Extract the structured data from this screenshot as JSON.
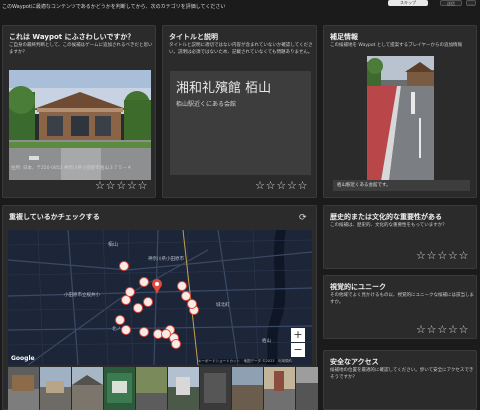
{
  "header": {
    "instruction": "このWaypotに最適なコンテンツであるかどうかを判断してから、次のカテゴリを評価してください",
    "skip_label": "スキップ",
    "next_label": "送信",
    "more_label": "…"
  },
  "eligibility": {
    "title": "これは Waypot にふさわしいですか？",
    "description": "ご自身の最終判断として、この候補はゲームに追加されるべきだと思いますか？",
    "address": "住所: 日本、〒250-0852 神奈川県小田原市栢山３７５－４",
    "stars": "☆☆☆☆☆"
  },
  "title_card": {
    "title": "タイトルと説明",
    "description": "タイトルと説明に適切ではない内容が含まれていないか確認してください。説明は必須ではないため、記載されていなくても問題ありません。",
    "poi_title": "湘和礼殯館 栢山",
    "poi_description": "栢山駅近くにある会館",
    "stars": "☆☆☆☆☆"
  },
  "supplementary": {
    "title": "補足情報",
    "description": "この候補地を Waypot として提案するプレイヤーからの追加情報",
    "caption": "栢山駅近くある会館です。",
    "stars": "☆☆☆☆☆"
  },
  "duplicates": {
    "title": "重複しているかチェックする",
    "map_labels": [
      "栢山",
      "神奈川県小田原市",
      "小田原市立桜井小",
      "城北町",
      "北ノ…",
      "栢山"
    ],
    "google_label": "Google",
    "attribution": "キーボードショートカット　地図データ ©2023　利用規約",
    "zoom_in": "+",
    "zoom_out": "−",
    "refresh_icon": "refresh-icon"
  },
  "historic": {
    "title": "歴史的または文化的な重要性がある",
    "description": "この候補は、歴史的、文化的な重要性をもっていますか？",
    "stars": "☆☆☆☆☆"
  },
  "visual": {
    "title": "視覚的にユニーク",
    "description": "その他域でよく見かけるもの以、視覚的にユニークな候補には該当しますか。",
    "stars": "☆☆☆☆☆"
  },
  "safe_access": {
    "title": "安全なアクセス",
    "description": "候補地の位置を最適的に確認してください。歩いて安全にアクセスできそうですか？"
  },
  "colors": {
    "accent": "#e34a3a",
    "marker": "#f6e7e4",
    "card_bg": "#2b2b2b",
    "page_bg": "#1b1b1b"
  }
}
